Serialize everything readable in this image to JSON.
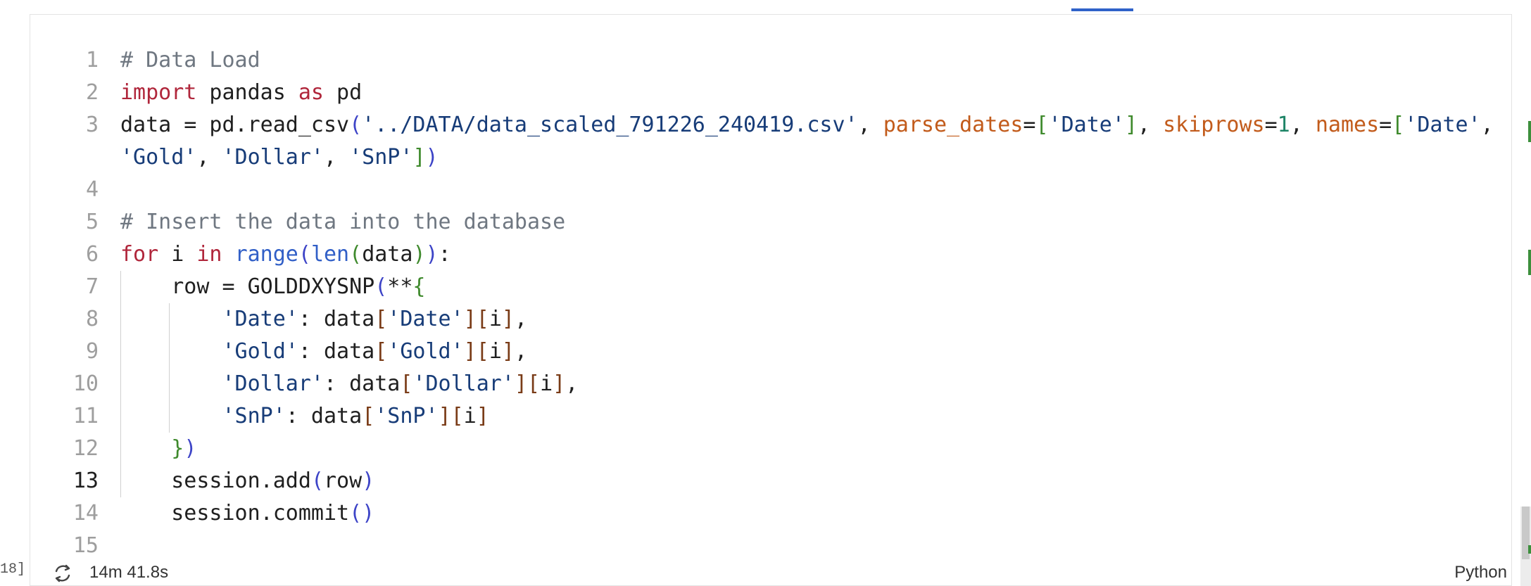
{
  "editor": {
    "language": "Python",
    "active_line": 13,
    "lines": [
      {
        "number": "1",
        "segments": [
          {
            "t": "# Data Load",
            "c": "com"
          }
        ]
      },
      {
        "number": "2",
        "segments": [
          {
            "t": "import",
            "c": "kw"
          },
          {
            "t": " pandas "
          },
          {
            "t": "as",
            "c": "kw"
          },
          {
            "t": " pd"
          }
        ]
      },
      {
        "number": "3",
        "segments": [
          {
            "t": "data = pd.read_csv"
          },
          {
            "t": "(",
            "c": "b1"
          },
          {
            "t": "'../DATA/data_scaled_791226_240419.csv'",
            "c": "str"
          },
          {
            "t": ", "
          },
          {
            "t": "parse_dates",
            "c": "par"
          },
          {
            "t": "="
          },
          {
            "t": "[",
            "c": "b2"
          },
          {
            "t": "'Date'",
            "c": "str"
          },
          {
            "t": "]",
            "c": "b2"
          },
          {
            "t": ", "
          },
          {
            "t": "skiprows",
            "c": "par"
          },
          {
            "t": "="
          },
          {
            "t": "1",
            "c": "num"
          },
          {
            "t": ", "
          },
          {
            "t": "names",
            "c": "par"
          },
          {
            "t": "="
          },
          {
            "t": "[",
            "c": "b2"
          },
          {
            "t": "'Date'",
            "c": "str"
          },
          {
            "t": ","
          }
        ]
      },
      {
        "number": "",
        "segments": [
          {
            "t": "'Gold'",
            "c": "str"
          },
          {
            "t": ", "
          },
          {
            "t": "'Dollar'",
            "c": "str"
          },
          {
            "t": ", "
          },
          {
            "t": "'SnP'",
            "c": "str"
          },
          {
            "t": "]",
            "c": "b2"
          },
          {
            "t": ")",
            "c": "b1"
          }
        ]
      },
      {
        "number": "4",
        "segments": []
      },
      {
        "number": "5",
        "segments": [
          {
            "t": "# Insert the data into the database",
            "c": "com"
          }
        ]
      },
      {
        "number": "6",
        "segments": [
          {
            "t": "for",
            "c": "kw"
          },
          {
            "t": " i "
          },
          {
            "t": "in",
            "c": "kw"
          },
          {
            "t": " "
          },
          {
            "t": "range",
            "c": "fn"
          },
          {
            "t": "(",
            "c": "b1"
          },
          {
            "t": "len",
            "c": "fn"
          },
          {
            "t": "(",
            "c": "b2"
          },
          {
            "t": "data"
          },
          {
            "t": ")",
            "c": "b2"
          },
          {
            "t": ")",
            "c": "b1"
          },
          {
            "t": ":"
          }
        ]
      },
      {
        "number": "7",
        "segments": [
          {
            "t": "    row = GOLDDXYSNP"
          },
          {
            "t": "(",
            "c": "b1"
          },
          {
            "t": "**"
          },
          {
            "t": "{",
            "c": "b2"
          }
        ]
      },
      {
        "number": "8",
        "segments": [
          {
            "t": "        "
          },
          {
            "t": "'Date'",
            "c": "str"
          },
          {
            "t": ": data"
          },
          {
            "t": "[",
            "c": "b3"
          },
          {
            "t": "'Date'",
            "c": "str"
          },
          {
            "t": "]",
            "c": "b3"
          },
          {
            "t": "[",
            "c": "b3"
          },
          {
            "t": "i"
          },
          {
            "t": "]",
            "c": "b3"
          },
          {
            "t": ","
          }
        ]
      },
      {
        "number": "9",
        "segments": [
          {
            "t": "        "
          },
          {
            "t": "'Gold'",
            "c": "str"
          },
          {
            "t": ": data"
          },
          {
            "t": "[",
            "c": "b3"
          },
          {
            "t": "'Gold'",
            "c": "str"
          },
          {
            "t": "]",
            "c": "b3"
          },
          {
            "t": "[",
            "c": "b3"
          },
          {
            "t": "i"
          },
          {
            "t": "]",
            "c": "b3"
          },
          {
            "t": ","
          }
        ]
      },
      {
        "number": "10",
        "segments": [
          {
            "t": "        "
          },
          {
            "t": "'Dollar'",
            "c": "str"
          },
          {
            "t": ": data"
          },
          {
            "t": "[",
            "c": "b3"
          },
          {
            "t": "'Dollar'",
            "c": "str"
          },
          {
            "t": "]",
            "c": "b3"
          },
          {
            "t": "[",
            "c": "b3"
          },
          {
            "t": "i"
          },
          {
            "t": "]",
            "c": "b3"
          },
          {
            "t": ","
          }
        ]
      },
      {
        "number": "11",
        "segments": [
          {
            "t": "        "
          },
          {
            "t": "'SnP'",
            "c": "str"
          },
          {
            "t": ": data"
          },
          {
            "t": "[",
            "c": "b3"
          },
          {
            "t": "'SnP'",
            "c": "str"
          },
          {
            "t": "]",
            "c": "b3"
          },
          {
            "t": "[",
            "c": "b3"
          },
          {
            "t": "i"
          },
          {
            "t": "]",
            "c": "b3"
          }
        ]
      },
      {
        "number": "12",
        "segments": [
          {
            "t": "    "
          },
          {
            "t": "}",
            "c": "b2"
          },
          {
            "t": ")",
            "c": "b1"
          }
        ]
      },
      {
        "number": "13",
        "segments": [
          {
            "t": "    session.add"
          },
          {
            "t": "(",
            "c": "b1"
          },
          {
            "t": "row"
          },
          {
            "t": ")",
            "c": "b1"
          }
        ]
      },
      {
        "number": "14",
        "segments": [
          {
            "t": "    session.commit"
          },
          {
            "t": "()",
            "c": "b1"
          }
        ]
      },
      {
        "number": "15",
        "segments": []
      }
    ]
  },
  "status_bar": {
    "execution_count": "18]",
    "duration": "14m 41.8s",
    "language": "Python",
    "icon": "refresh-icon"
  },
  "colors": {
    "comment": "#6f7781",
    "keyword": "#b0263b",
    "function": "#315fc7",
    "string": "#173c78",
    "parameter": "#c25b1b",
    "number": "#1d8466",
    "bracket_level_1": "#3d44c7",
    "bracket_level_2": "#3f8a2d",
    "bracket_level_3": "#7a3c18",
    "accent": "#2f62c9"
  }
}
